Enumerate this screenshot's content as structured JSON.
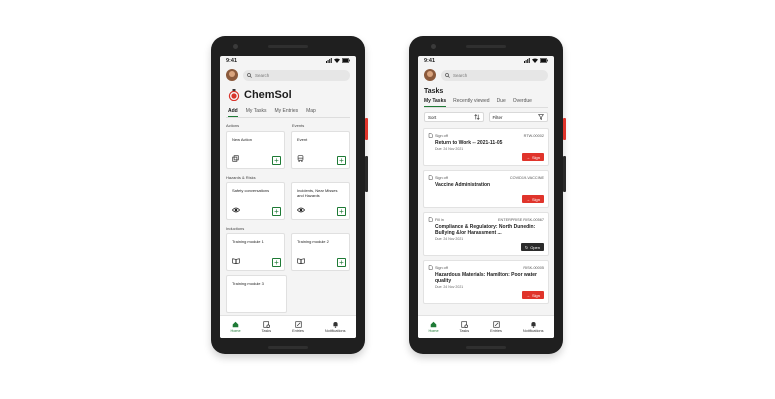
{
  "phone_left": {
    "status": {
      "time": "9:41"
    },
    "search": {
      "placeholder": "Search"
    },
    "brand": {
      "name": "ChemSol"
    },
    "tabs": [
      "Add",
      "My Tasks",
      "My Entries",
      "Map"
    ],
    "sections": {
      "actions": "Actions",
      "events": "Events",
      "hazards": "Hazards & Risks",
      "inductions": "Inductions"
    },
    "cards": {
      "new_action": "New Action",
      "event": "Event",
      "safety_conversations": "Safety conversations",
      "incidents": "Incidents, Near Misses and Hazards",
      "training_1": "Training module 1",
      "training_2": "Training module 2",
      "training_3": "Training module 3"
    },
    "nav": [
      "Home",
      "Tasks",
      "Entries",
      "Notifications"
    ]
  },
  "phone_right": {
    "status": {
      "time": "9:41"
    },
    "search": {
      "placeholder": "Search"
    },
    "heading": "Tasks",
    "tabs": [
      "My Tasks",
      "Recently viewed",
      "Due",
      "Overdue"
    ],
    "sort_label": "Sort",
    "filter_label": "Filter",
    "tasks": [
      {
        "type": "Sign off",
        "code": "RTW-00002",
        "name": "Return to Work -- 2021-11-05",
        "due": "Due: 24 Nov 2021",
        "button": "Sign"
      },
      {
        "type": "Sign off",
        "code": "COVID19-VACCINE",
        "name": "Vaccine Administration",
        "due": "",
        "button": "Sign"
      },
      {
        "type": "Fill in",
        "code": "ENTERPRISE RISK-00567",
        "name": "Compliance & Regulatory: North Dunedin: Bullying &/or Harassment ...",
        "due": "Due: 24 Nov 2021",
        "button": "Open"
      },
      {
        "type": "Sign off",
        "code": "RISK-00005",
        "name": "Hazardous Materials: Hamilton: Poor water quality",
        "due": "Due: 24 Nov 2021",
        "button": "Sign"
      }
    ],
    "nav": [
      "Home",
      "Tasks",
      "Entries",
      "Notifications"
    ]
  },
  "colors": {
    "accent": "#1e7a35",
    "sign": "#e0342b",
    "open": "#2b2b2b",
    "logo": "#d9342b",
    "side_button_left": "#e0342b"
  }
}
